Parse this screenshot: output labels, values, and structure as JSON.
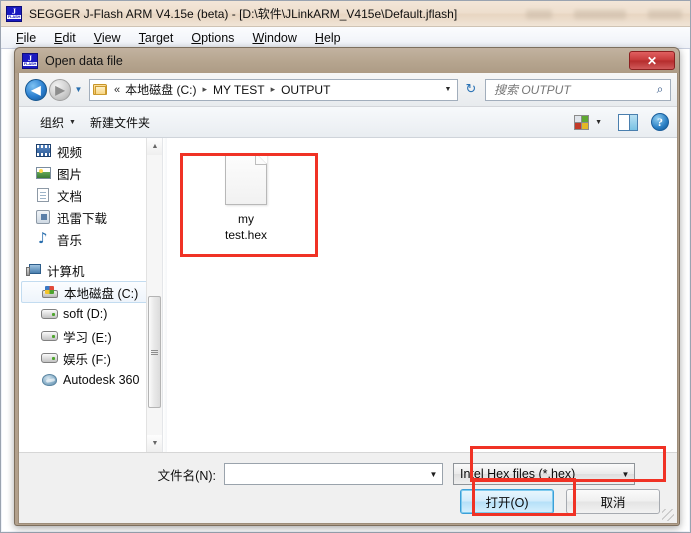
{
  "app": {
    "title": "SEGGER J-Flash ARM V4.15e (beta) - [D:\\软件\\JLinkARM_V415e\\Default.jflash]",
    "icon": "jflash-icon",
    "icon_letter": "J",
    "icon_word": "FLASH",
    "menu": [
      {
        "label": "File",
        "accel": "F"
      },
      {
        "label": "Edit",
        "accel": "E"
      },
      {
        "label": "View",
        "accel": "V"
      },
      {
        "label": "Target",
        "accel": "T"
      },
      {
        "label": "Options",
        "accel": "O"
      },
      {
        "label": "Window",
        "accel": "W"
      },
      {
        "label": "Help",
        "accel": "H"
      }
    ]
  },
  "dialog": {
    "title": "Open data file",
    "close_label": "✕",
    "nav": {
      "back_icon": "back-arrow-icon",
      "back_glyph": "◀",
      "forward_icon": "forward-arrow-icon",
      "forward_glyph": "▶",
      "history_glyph": "▼",
      "folder_icon": "folder-icon",
      "overflow": "«",
      "crumbs": [
        "本地磁盘 (C:)",
        "MY TEST",
        "OUTPUT"
      ],
      "separator": "▸",
      "dropdown_glyph": "▼",
      "refresh_icon": "refresh-icon",
      "refresh_glyph": "↻"
    },
    "search": {
      "placeholder": "搜索 OUTPUT",
      "value": "",
      "icon": "search-icon",
      "icon_glyph": "⌕"
    },
    "toolbar": {
      "organize_label": "组织",
      "organize_caret": "▼",
      "new_folder_label": "新建文件夹",
      "view_icon": "view-mode-grid-icon",
      "view_caret": "▼",
      "preview_icon": "preview-pane-icon",
      "help_icon": "help-icon",
      "help_glyph": "?"
    },
    "nav_pane": {
      "items": [
        {
          "label": "视频",
          "icon": "video-library-icon",
          "type": "item"
        },
        {
          "label": "图片",
          "icon": "pictures-library-icon",
          "type": "item"
        },
        {
          "label": "文档",
          "icon": "documents-library-icon",
          "type": "item"
        },
        {
          "label": "迅雷下载",
          "icon": "thunder-download-icon",
          "type": "item"
        },
        {
          "label": "音乐",
          "icon": "music-library-icon",
          "type": "item"
        },
        {
          "label": "计算机",
          "icon": "computer-icon",
          "type": "group"
        },
        {
          "label": "本地磁盘 (C:)",
          "icon": "system-drive-icon",
          "type": "drive",
          "selected": true
        },
        {
          "label": "soft (D:)",
          "icon": "drive-icon",
          "type": "drive"
        },
        {
          "label": "学习 (E:)",
          "icon": "drive-icon",
          "type": "drive"
        },
        {
          "label": "娱乐 (F:)",
          "icon": "drive-icon",
          "type": "drive"
        },
        {
          "label": "Autodesk 360",
          "icon": "autodesk-360-icon",
          "type": "drive"
        }
      ],
      "scroll_up_glyph": "▲",
      "scroll_down_glyph": "▼"
    },
    "file_list": {
      "items": [
        {
          "name": "my\ntest.hex",
          "icon": "generic-file-icon"
        }
      ]
    },
    "footer": {
      "filename_label": "文件名(N):",
      "filename_value": "",
      "filename_caret": "▼",
      "filetype_value": "Intel Hex files (*.hex)",
      "filetype_caret": "▼",
      "open_button": "打开(O)",
      "cancel_button": "取消"
    }
  },
  "annotations": {
    "color": "#f03225",
    "boxes": [
      "file-item",
      "file-type-filter",
      "open-button"
    ]
  }
}
